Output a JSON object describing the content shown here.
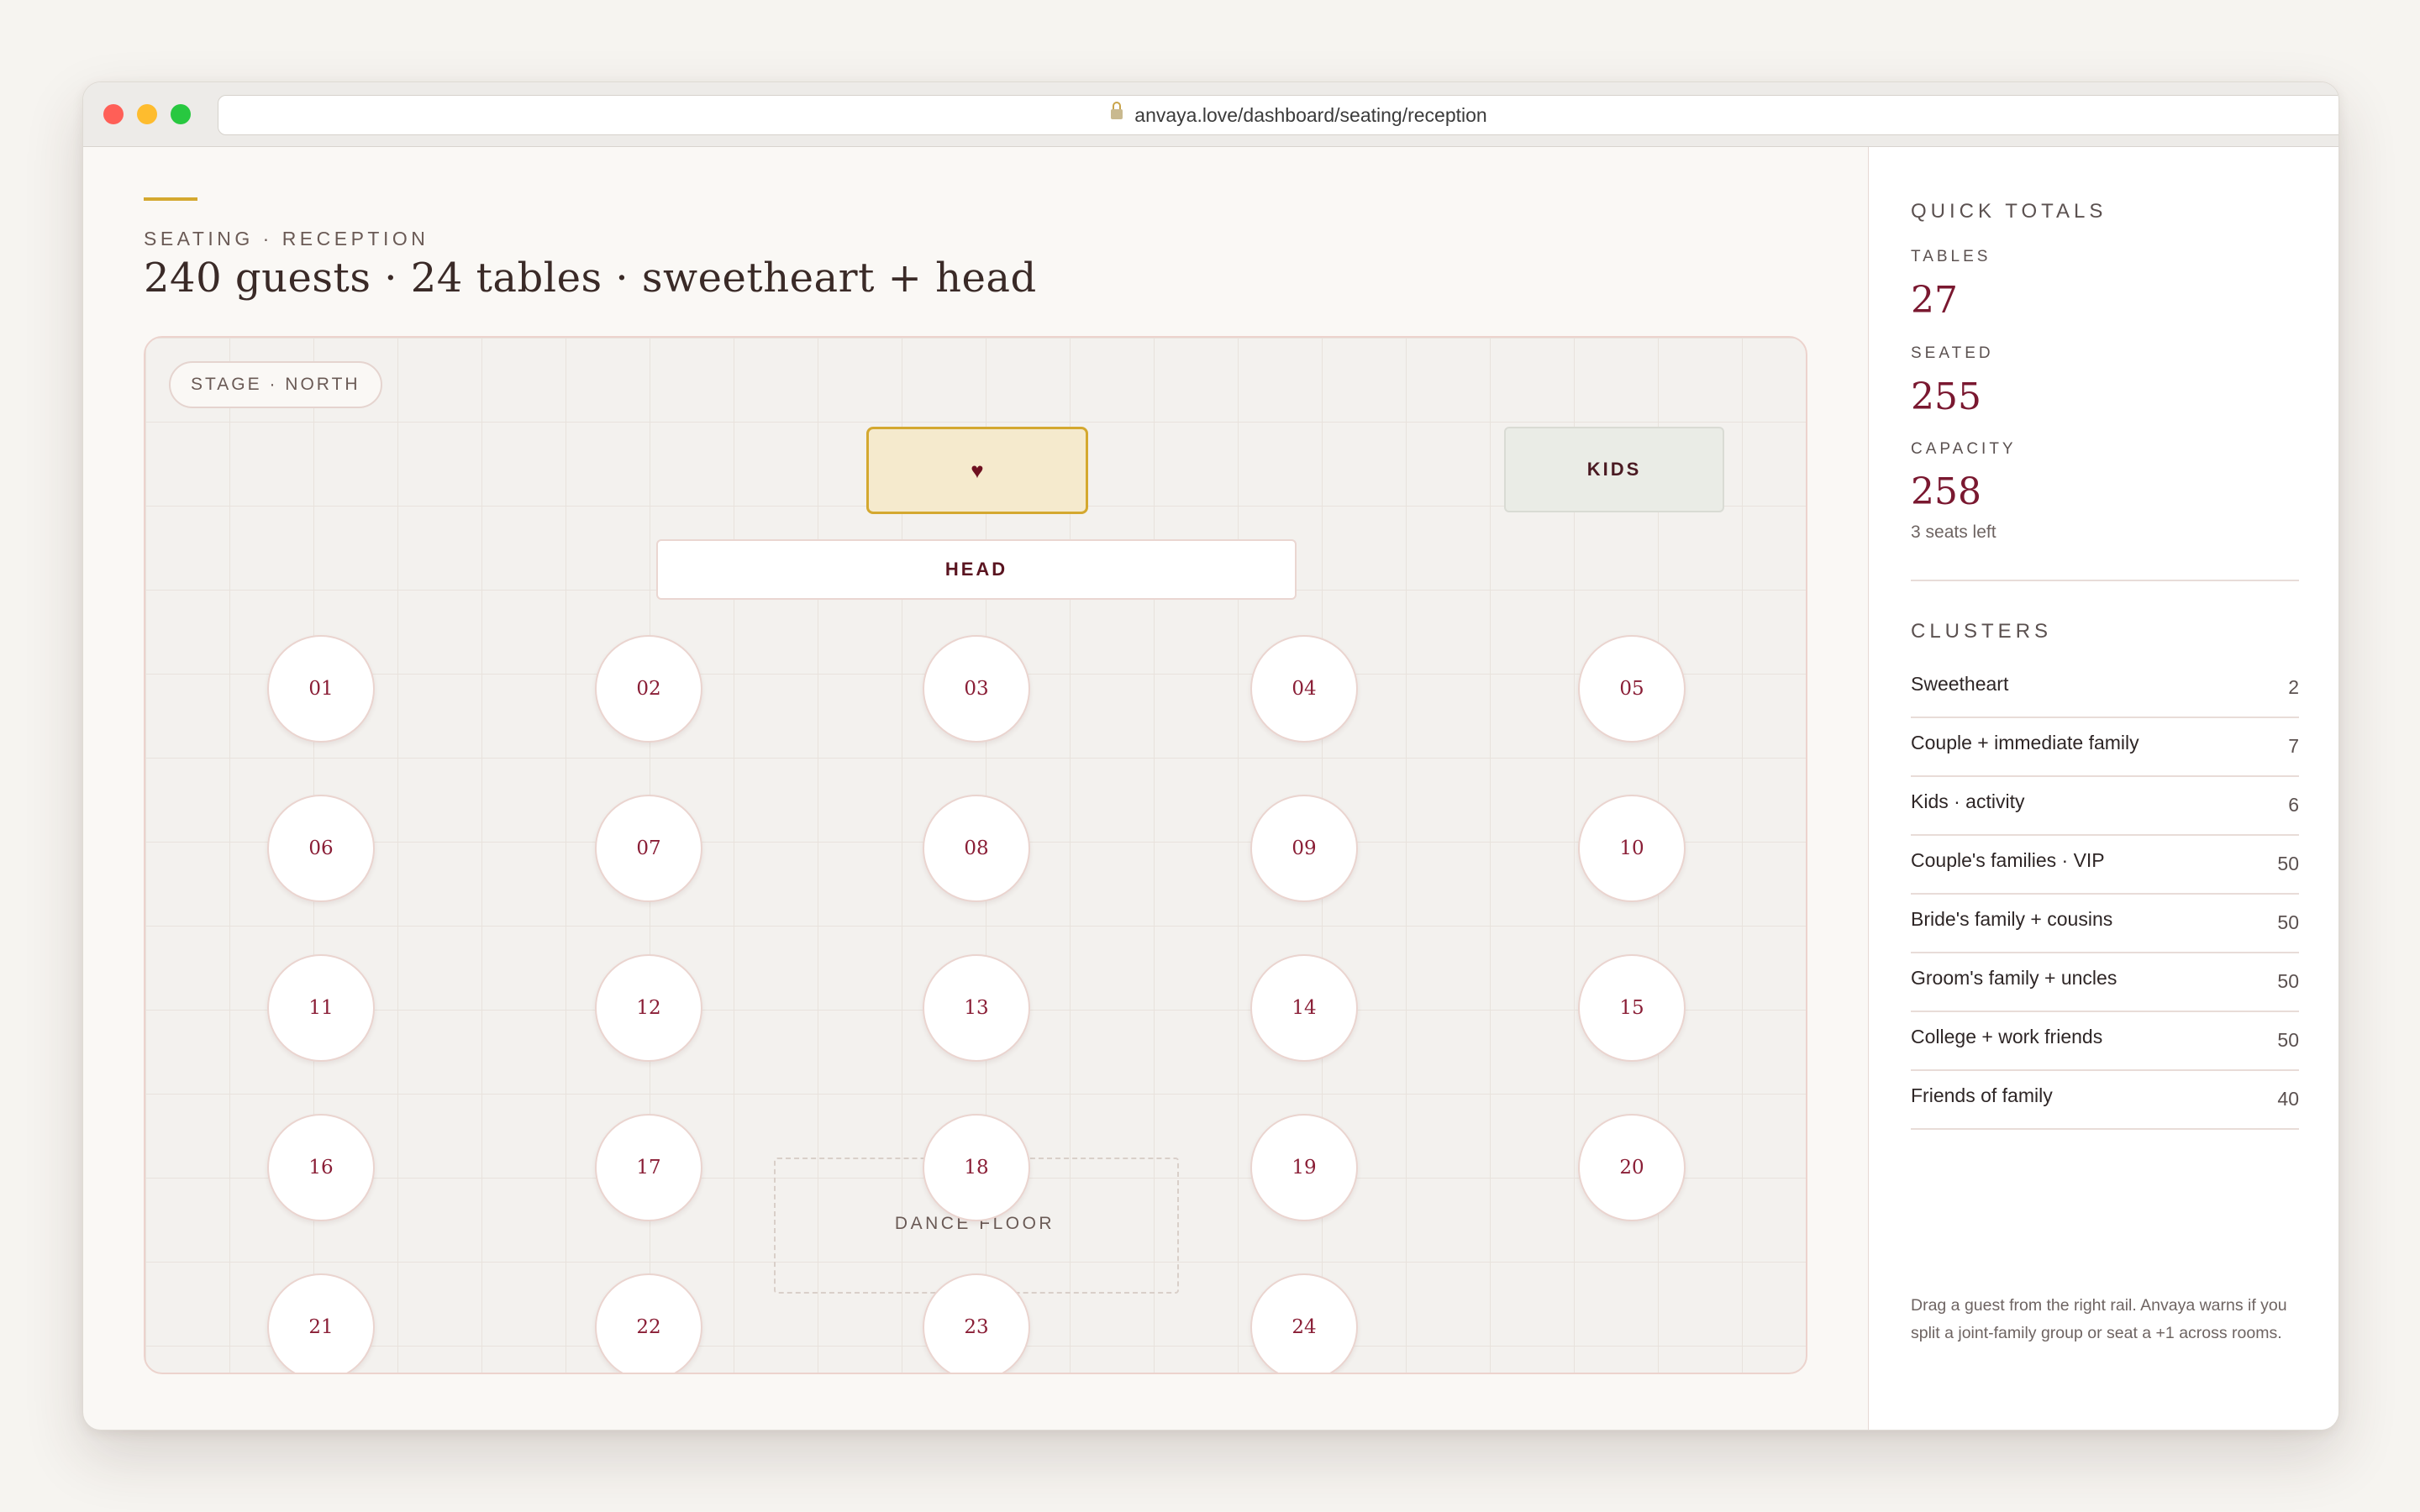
{
  "browser": {
    "url": "anvaya.love/dashboard/seating/reception"
  },
  "page": {
    "eyebrow": "SEATING · RECEPTION",
    "headline": "240 guests · 24 tables · sweetheart + head"
  },
  "floor": {
    "stage_label": "STAGE · NORTH",
    "sweetheart_symbol": "♥",
    "kids_label": "KIDS",
    "head_label": "HEAD",
    "dance_floor_label": "DANCE FLOOR",
    "tables": [
      "01",
      "02",
      "03",
      "04",
      "05",
      "06",
      "07",
      "08",
      "09",
      "10",
      "11",
      "12",
      "13",
      "14",
      "15",
      "16",
      "17",
      "18",
      "19",
      "20",
      "21",
      "22",
      "23",
      "24"
    ]
  },
  "rail": {
    "totals_heading": "QUICK TOTALS",
    "tables_label": "TABLES",
    "tables_value": "27",
    "seated_label": "SEATED",
    "seated_value": "255",
    "capacity_label": "CAPACITY",
    "capacity_value": "258",
    "seats_left": "3 seats left",
    "clusters_heading": "CLUSTERS",
    "clusters": [
      {
        "name": "Sweetheart",
        "count": "2"
      },
      {
        "name": "Couple + immediate family",
        "count": "7"
      },
      {
        "name": "Kids · activity",
        "count": "6"
      },
      {
        "name": "Couple's families · VIP",
        "count": "50"
      },
      {
        "name": "Bride's family + cousins",
        "count": "50"
      },
      {
        "name": "Groom's family + uncles",
        "count": "50"
      },
      {
        "name": "College + work friends",
        "count": "50"
      },
      {
        "name": "Friends of family",
        "count": "40"
      }
    ],
    "footer": "Drag a guest from the right rail. Anvaya warns if you split a joint-family group or seat a +1 across rooms."
  }
}
